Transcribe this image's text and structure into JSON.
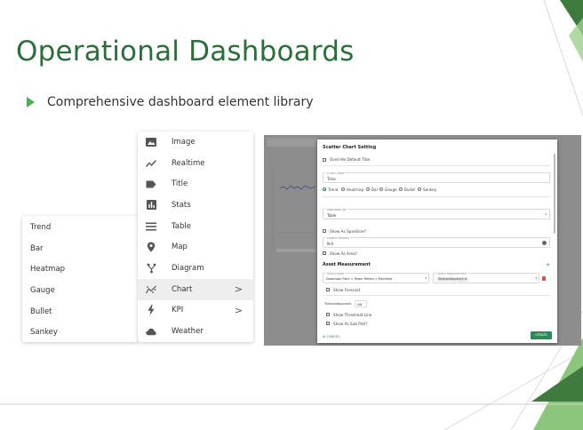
{
  "slide": {
    "title": "Operational Dashboards",
    "bullet": "Comprehensive dashboard element library"
  },
  "colors": {
    "title": "#2a6e3a",
    "accent_green": "#4caf50",
    "dark_green": "#2e8b57"
  },
  "chart_submenu": {
    "items": [
      {
        "label": "Trend"
      },
      {
        "label": "Bar"
      },
      {
        "label": "Heatmap"
      },
      {
        "label": "Gauge"
      },
      {
        "label": "Bullet"
      },
      {
        "label": "Sankey"
      }
    ]
  },
  "element_menu": {
    "items": [
      {
        "label": "Image",
        "icon": "image-icon"
      },
      {
        "label": "Realtime",
        "icon": "trend-line-icon"
      },
      {
        "label": "Title",
        "icon": "label-tag-icon"
      },
      {
        "label": "Stats",
        "icon": "bar-stats-icon"
      },
      {
        "label": "Table",
        "icon": "table-lines-icon"
      },
      {
        "label": "Map",
        "icon": "map-pin-icon"
      },
      {
        "label": "Diagram",
        "icon": "diagram-branch-icon"
      },
      {
        "label": "Chart",
        "icon": "scatter-chart-icon",
        "chevron": ">",
        "active": true
      },
      {
        "label": "KPI",
        "icon": "lightning-bolt-icon",
        "chevron": ">"
      },
      {
        "label": "Weather",
        "icon": "cloud-icon"
      }
    ]
  },
  "settings_dialog": {
    "title": "Scatter Chart Setting",
    "override_title": "Override Default Title",
    "x_axis_label_caption": "X Axis Label",
    "x_axis_label_value": "Time",
    "chart_types": [
      "Trend",
      "Heatmap",
      "Bar",
      "Gauge",
      "Bullet",
      "Sankey"
    ],
    "aggregate_caption": "Aggregate By",
    "aggregate_value": "Table",
    "show_sparkline": "Show As Sparkline?",
    "legend_caption": "Legend Position",
    "legend_value": "N-A",
    "show_area": "Show As Area?",
    "asset_section": "Asset Measurement",
    "add_symbol": "+",
    "select_asset_caption": "Select Asset",
    "select_asset_value": "Downtown Plant > Power Meters > Mainfeed",
    "select_measurement_caption": "Select Measurement",
    "select_measurement_chip": "TotalizedApparent",
    "show_forecast": "Show Forecast",
    "measurement_name": "TotalizedApparent",
    "measurement_unit": "kW",
    "show_threshold": "Show Threshold Line",
    "show_subplot": "Show As Sub Plot?",
    "cancel": "CANCEL",
    "update": "UPDATE"
  }
}
